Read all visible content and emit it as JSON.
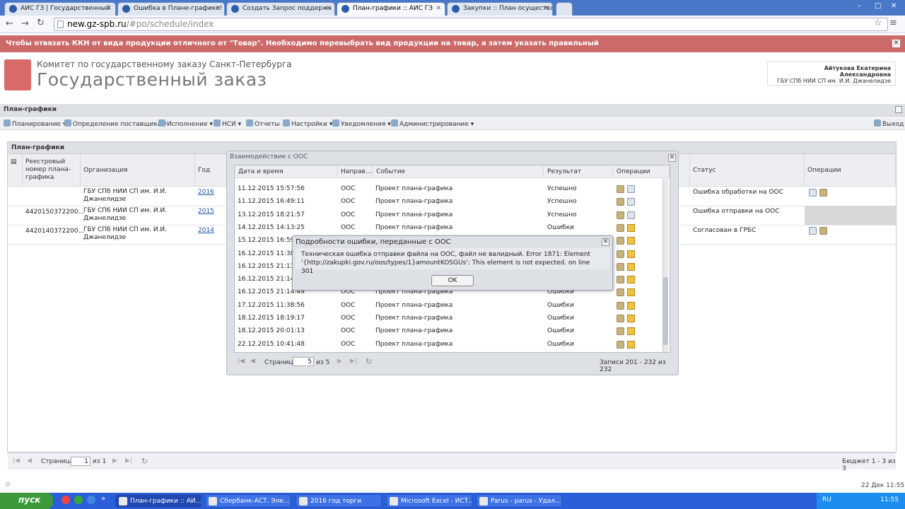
{
  "browser": {
    "tabs": [
      {
        "title": "АИС ГЗ | Государственный",
        "active": false
      },
      {
        "title": "Ошибка в Плане-графике!",
        "active": false
      },
      {
        "title": "Создать Запрос поддержк",
        "active": false
      },
      {
        "title": "План-графики :: АИС ГЗ",
        "active": true
      },
      {
        "title": "Закупки :: План осуществл",
        "active": false
      }
    ],
    "url_host": "new.gz-spb.ru",
    "url_path": "/#po/schedule/index"
  },
  "banner": {
    "text": "Чтобы отвязать ККН от вида продукции отличного от \"Товар\". Необходимо перевыбрать вид продукции на товар, а затем указать правильный",
    "color": "#cc6a6a"
  },
  "header": {
    "org_line1": "Комитет по государственному заказу Санкт-Петербурга",
    "org_line2": "Государственный заказ",
    "user_name": "Айтукова Екатерина Александровна",
    "user_org": "ГБУ СПб НИИ СП им. И.И. Джанелидзе"
  },
  "panel": {
    "title": "План-графики",
    "grid_title": "План-графики"
  },
  "menu": {
    "items": [
      "Планирование",
      "Определение поставщика",
      "Исполнение",
      "НСИ",
      "Отчеты",
      "Настройки",
      "Уведомления",
      "Администрирование"
    ],
    "exit": "Выход"
  },
  "main_table": {
    "headers": {
      "reg": "Реестровый номер плана-графика",
      "org": "Организация",
      "year": "Год",
      "status": "Статус",
      "ops": "Операции"
    },
    "rows": [
      {
        "reg": "",
        "org": "ГБУ СПб НИИ СП им. И.И. Джанелидзе",
        "year": "2016",
        "status": "Ошибка обработки на ООС"
      },
      {
        "reg": "4420150372200...",
        "org": "ГБУ СПб НИИ СП им. И.И. Джанелидзе",
        "year": "2015",
        "status": "Ошибка отправки на ООС"
      },
      {
        "reg": "4420140372200...",
        "org": "ГБУ СПб НИИ СП им. И.И. Джанелидзе",
        "year": "2014",
        "status": "Согласован в ГРБС"
      }
    ],
    "pager": {
      "page_label": "Страница",
      "page": "1",
      "of": "из 1",
      "summary": "Бюджет 1 - 3 из 3"
    }
  },
  "dialog": {
    "title": "Взаимодействие с ООС",
    "headers": {
      "date": "Дата и время",
      "dir": "Направ...",
      "event": "Событие",
      "result": "Результат",
      "ops": "Операции"
    },
    "rows": [
      {
        "date": "11.12.2015 15:57:56",
        "dir": "ООС",
        "event": "Проект плана-графика",
        "result": "Успешно",
        "warn": false
      },
      {
        "date": "11.12.2015 16:49:11",
        "dir": "ООС",
        "event": "Проект плана-графика",
        "result": "Успешно",
        "warn": false
      },
      {
        "date": "13.12.2015 18:21:57",
        "dir": "ООС",
        "event": "Проект плана-графика",
        "result": "Успешно",
        "warn": false
      },
      {
        "date": "14.12.2015 14:13:25",
        "dir": "ООС",
        "event": "Проект плана-графика",
        "result": "Ошибки",
        "warn": true
      },
      {
        "date": "15.12.2015 16:59:3",
        "dir": "",
        "event": "",
        "result": "",
        "warn": true
      },
      {
        "date": "16.12.2015 11:38:0",
        "dir": "",
        "event": "",
        "result": "",
        "warn": true
      },
      {
        "date": "16.12.2015 21:13:5",
        "dir": "",
        "event": "",
        "result": "",
        "warn": true
      },
      {
        "date": "16.12.2015 21:14:2",
        "dir": "",
        "event": "",
        "result": "",
        "warn": true
      },
      {
        "date": "16.12.2015 21:14:49",
        "dir": "ООС",
        "event": "Проект плана-графика",
        "result": "Ошибки",
        "warn": true
      },
      {
        "date": "17.12.2015 11:38:56",
        "dir": "ООС",
        "event": "Проект плана-графика",
        "result": "Ошибки",
        "warn": true
      },
      {
        "date": "18.12.2015 18:19:17",
        "dir": "ООС",
        "event": "Проект плана-графика",
        "result": "Ошибки",
        "warn": true
      },
      {
        "date": "18.12.2015 20:01:13",
        "dir": "ООС",
        "event": "Проект плана-графика",
        "result": "Ошибки",
        "warn": true
      },
      {
        "date": "22.12.2015 10:41:48",
        "dir": "ООС",
        "event": "Проект плана-графика",
        "result": "Ошибки",
        "warn": true
      }
    ],
    "pager": {
      "page_label": "Страница",
      "page": "5",
      "of": "из 5",
      "summary": "Записи 201 - 232 из 232"
    }
  },
  "error": {
    "title": "Подробности ошибки, переданные с ООС",
    "message": "Техническая ошибка отправки файла на ООС, файл не валидный. Error 1871: Element '{http://zakupki.gov.ru/oos/types/1}amountKOSGUs': This element is not expected. on line 301",
    "ok": "OK"
  },
  "statusbar": {
    "date": "22 Дек 11:55"
  },
  "taskbar": {
    "start": "пуск",
    "items": [
      "План-графики :: АИ...",
      "Сбербанк-АСТ. Эле...",
      "2016 год торги",
      "Microsoft Excel - ИСТ...",
      "Parus - parus - Удал..."
    ],
    "lang": "RU",
    "time": "11:55"
  }
}
